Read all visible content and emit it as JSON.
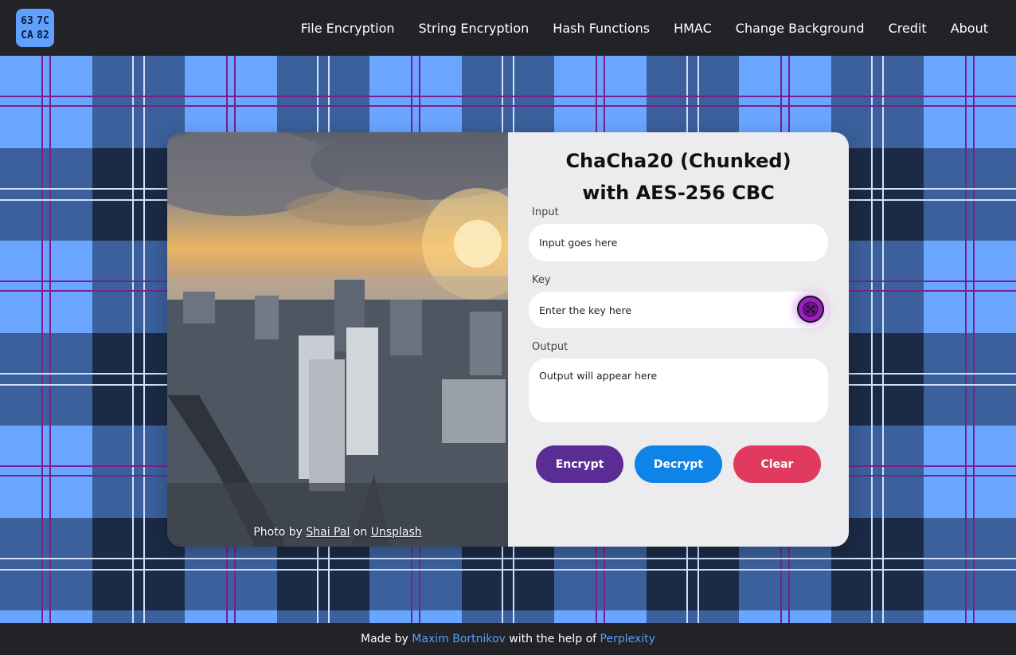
{
  "header": {
    "logo_cells": [
      "63",
      "7C",
      "CA",
      "82"
    ],
    "nav": [
      {
        "label": "File Encryption"
      },
      {
        "label": "String Encryption"
      },
      {
        "label": "Hash Functions"
      },
      {
        "label": "HMAC"
      },
      {
        "label": "Change Background"
      },
      {
        "label": "Credit"
      },
      {
        "label": "About"
      }
    ]
  },
  "photo_credit": {
    "prefix": "Photo by ",
    "author": "Shai Pal",
    "middle": " on ",
    "site": "Unsplash"
  },
  "panel": {
    "title_line1": "ChaCha20 (Chunked)",
    "title_line2": "with AES-256 CBC",
    "input": {
      "label": "Input",
      "placeholder": "Input goes here"
    },
    "key": {
      "label": "Key",
      "placeholder": "Enter the key here",
      "button_icon": "dice-icon"
    },
    "output": {
      "label": "Output",
      "placeholder": "Output will appear here"
    },
    "buttons": {
      "encrypt": "Encrypt",
      "decrypt": "Decrypt",
      "clear": "Clear"
    }
  },
  "footer": {
    "prefix": "Made by ",
    "author": "Maxim Bortnikov",
    "middle": " with the help of ",
    "tool": "Perplexity"
  },
  "colors": {
    "accent_blue": "#5b9cff",
    "encrypt": "#5b2d94",
    "decrypt": "#0f84e8",
    "clear": "#e03a5e",
    "key_button": "#9c1fc0",
    "tartan_light": "#6aa5ff",
    "tartan_mid": "#33548a",
    "tartan_dark": "#1b2a45",
    "tartan_stripe": "#7a1f8c"
  }
}
